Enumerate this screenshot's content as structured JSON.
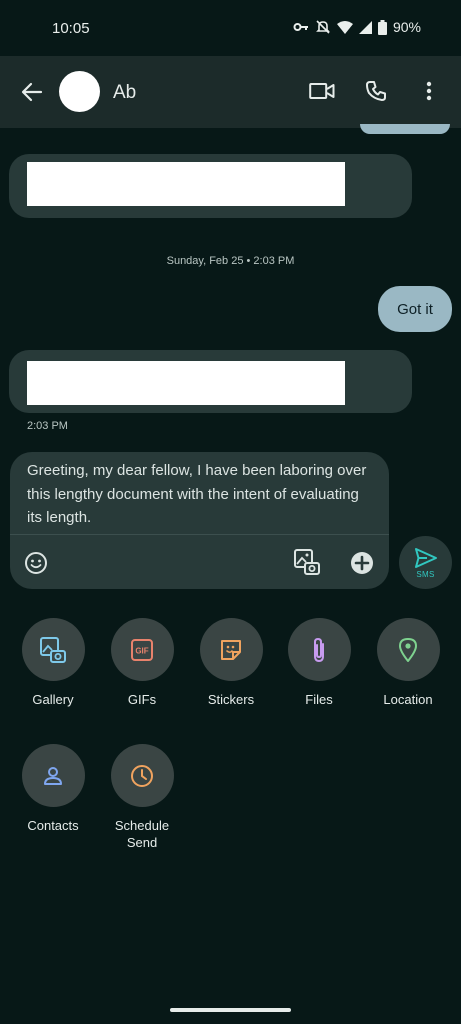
{
  "status_bar": {
    "time": "10:05",
    "battery": "90%",
    "icons": [
      "key-icon",
      "mute-icon",
      "wifi-icon",
      "signal-icon",
      "battery-icon"
    ]
  },
  "app_bar": {
    "contact_name": "Ab",
    "actions": [
      "back-icon",
      "video-call-icon",
      "phone-icon",
      "more-vert-icon"
    ]
  },
  "conversation": {
    "date_separator": "Sunday, Feb 25 • 2:03 PM",
    "outgoing_message": "Got it",
    "last_message_time": "2:03 PM"
  },
  "composer": {
    "draft_text": "Greeting, my dear fellow, I have been laboring over this lengthy document with the intent of evaluating its length.",
    "send_label": "SMS"
  },
  "attachments": [
    {
      "label": "Gallery",
      "icon": "gallery-icon"
    },
    {
      "label": "GIFs",
      "icon": "gif-icon"
    },
    {
      "label": "Stickers",
      "icon": "sticker-icon"
    },
    {
      "label": "Files",
      "icon": "paperclip-icon"
    },
    {
      "label": "Location",
      "icon": "location-pin-icon"
    },
    {
      "label": "Contacts",
      "icon": "contact-person-icon"
    },
    {
      "label": "Schedule Send",
      "icon": "clock-icon"
    }
  ],
  "colors": {
    "background": "#071817",
    "app_bar": "#1c2b2a",
    "incoming_bubble": "#283a39",
    "outgoing_bubble": "#9ab8c4",
    "accent_send": "#31c7c0"
  }
}
